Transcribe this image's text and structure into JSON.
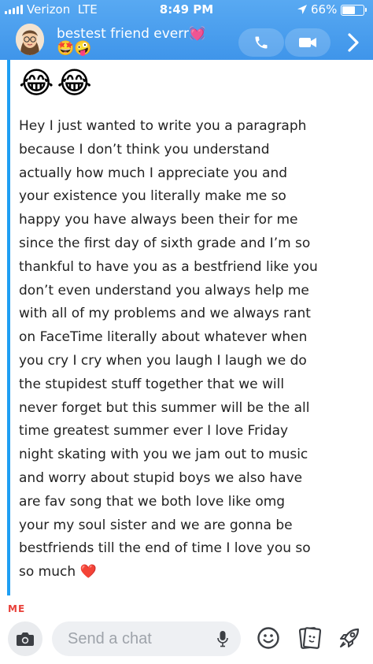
{
  "status_bar": {
    "carrier": "Verizon",
    "network": "LTE",
    "time": "8:49 PM",
    "battery_percent": "66%",
    "battery_level": 0.66
  },
  "chat_header": {
    "name": "bestest friend everr💓",
    "emojis": "🤩🤪",
    "icons": [
      "avatar",
      "phone-icon",
      "video-camera-icon",
      "chevron-right-icon"
    ]
  },
  "message": {
    "emoji_line": "😂😂",
    "lines": [
      "Hey I just wanted to write you a paragraph",
      "because I don’t think you understand",
      "actually how much I appreciate you and",
      "your existence you literally make me so",
      "happy you have always been their for me",
      "since the first day of sixth grade and I’m so",
      "thankful to have you as a bestfriend like you",
      "don’t even understand you always help me",
      "with all of my problems and we always rant",
      "on FaceTime literally about whatever when",
      "you cry I cry when you laugh I laugh we do",
      "the stupidest stuff together that we will",
      "never forget but this summer will be the all",
      "time greatest summer ever I love Friday",
      "night skating with you we jam out to music",
      "and worry about stupid boys we also have",
      "are fav song that we both love like omg",
      "your my soul sister and we are gonna be",
      "bestfriends till the end of time I love you so",
      "so much ❤️"
    ],
    "accent_color": "#1f9ff3"
  },
  "sender_label": "ME",
  "input_bar": {
    "placeholder": "Send a chat",
    "icons": [
      "camera-icon",
      "microphone-icon",
      "smiley-icon",
      "sticker-icon",
      "rocket-icon"
    ]
  },
  "colors": {
    "header": "#4a9ff0",
    "sender_label": "#e8413a"
  }
}
